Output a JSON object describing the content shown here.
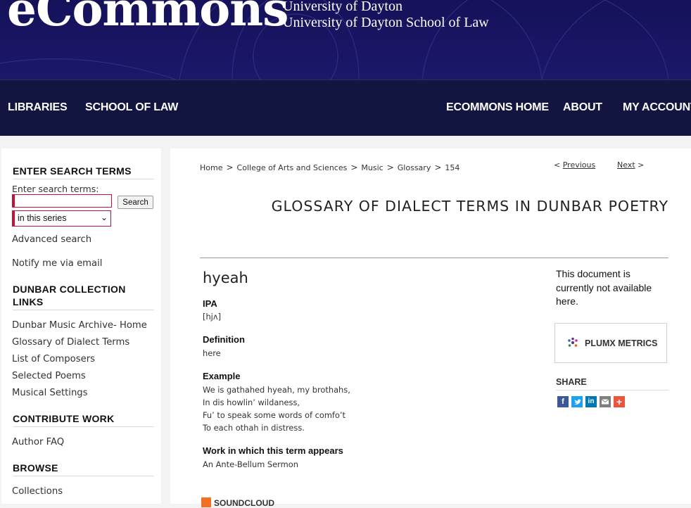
{
  "header": {
    "brand": "eCommons",
    "university": "University of Dayton",
    "school": "University of Dayton School of Law"
  },
  "nav": {
    "libraries": "LIBRARIES",
    "school_of_law": "SCHOOL OF LAW",
    "ecommons_home": "ECOMMONS HOME",
    "about": "ABOUT",
    "my_account": "MY ACCOUNT"
  },
  "sidebar": {
    "search_heading": "ENTER SEARCH TERMS",
    "search_label": "Enter search terms:",
    "search_value": "",
    "search_button": "Search",
    "scope_selected": "in this series",
    "advanced_search": "Advanced search",
    "notify": "Notify me via email",
    "collection_heading": "DUNBAR COLLECTION LINKS",
    "collection_links": [
      "Dunbar Music Archive- Home",
      "Glossary of Dialect Terms",
      "List of Composers",
      "Selected Poems",
      "Musical Settings"
    ],
    "contribute_heading": "CONTRIBUTE WORK",
    "author_faq": "Author FAQ",
    "browse_heading": "BROWSE",
    "collections": "Collections"
  },
  "breadcrumb": {
    "items": [
      "Home",
      "College of Arts and Sciences",
      "Music",
      "Glossary",
      "154"
    ],
    "separator": ">"
  },
  "pager": {
    "prev_arrow": "<",
    "previous": "Previous",
    "next": "Next",
    "next_arrow": ">"
  },
  "series_title": "GLOSSARY OF DIALECT TERMS IN DUNBAR POETRY",
  "entry": {
    "term": "hyeah",
    "ipa_label": "IPA",
    "ipa": "[hjʌ]",
    "definition_label": "Definition",
    "definition": "here",
    "example_label": "Example",
    "example_lines": [
      "We is gathahed hyeah, my brothahs,",
      "In dis howlin’ wildaness,",
      "Fu’ to speak some words of comfo’t",
      "To each othah in distress."
    ],
    "work_label": "Work in which this term appears",
    "work": "An Ante-Bellum Sermon"
  },
  "aside": {
    "availability": "This document is currently not available here.",
    "plumx": "PLUMX METRICS",
    "share_heading": "SHARE"
  },
  "soundcloud": "SOUNDCLOUD",
  "colors": {
    "banner": "#1a1764",
    "nav": "#121540",
    "accent_red": "#c0143c",
    "facebook": "#3b5998",
    "twitter": "#1da1f2",
    "linkedin": "#0077b5",
    "email": "#7f7f7f",
    "addthis": "#f0533b"
  }
}
